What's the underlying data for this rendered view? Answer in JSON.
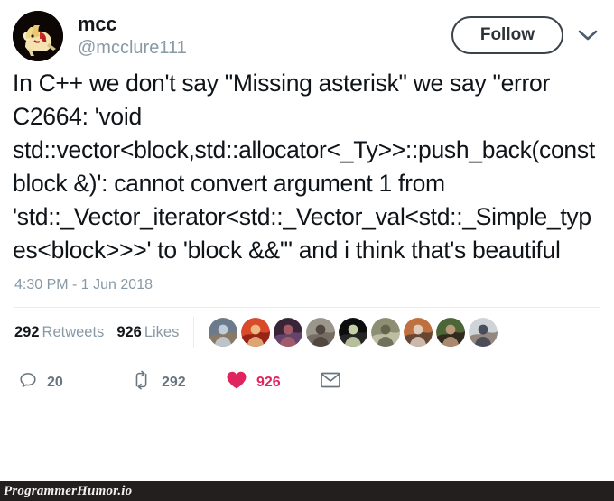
{
  "tweet": {
    "display_name": "mcc",
    "handle": "@mcclure111",
    "avatar_icon": "user-avatar-pony",
    "follow_label": "Follow",
    "caret_icon": "chevron-down-icon",
    "text": "In C++ we don't say \"Missing asterisk\" we say \"error C2664: 'void std::vector<block,std::allocator<_Ty>>::push_back(const block &)': cannot convert argument 1 from 'std::_Vector_iterator<std::_Vector_val<std::_Simple_types<block>>>' to 'block &&'\" and i think that's beautiful",
    "timestamp": "4:30 PM - 1 Jun 2018"
  },
  "stats": {
    "retweets_count": "292",
    "retweets_label": "Retweets",
    "likes_count": "926",
    "likes_label": "Likes",
    "liker_avatars": [
      {
        "name": "liker-avatar-1",
        "bg": "#6b7b8c",
        "fg": "#c9d6e2",
        "accent": "#8d7a5f"
      },
      {
        "name": "liker-avatar-2",
        "bg": "#d94a2b",
        "fg": "#f2c38a",
        "accent": "#8c1d12"
      },
      {
        "name": "liker-avatar-3",
        "bg": "#3a2438",
        "fg": "#b0616a",
        "accent": "#6d4a74"
      },
      {
        "name": "liker-avatar-4",
        "bg": "#9b968c",
        "fg": "#4a3f36",
        "accent": "#6e665c"
      },
      {
        "name": "liker-avatar-5",
        "bg": "#0d0d0d",
        "fg": "#d9e6b8",
        "accent": "#2b2b2b"
      },
      {
        "name": "liker-avatar-6",
        "bg": "#8d8f74",
        "fg": "#5d5f48",
        "accent": "#c5c6ad"
      },
      {
        "name": "liker-avatar-7",
        "bg": "#c0703e",
        "fg": "#e3d6cb",
        "accent": "#57402f"
      },
      {
        "name": "liker-avatar-8",
        "bg": "#4c6638",
        "fg": "#c9a184",
        "accent": "#2e2019"
      },
      {
        "name": "liker-avatar-9",
        "bg": "#cfd4d8",
        "fg": "#3a3f52",
        "accent": "#8a7a6e"
      }
    ]
  },
  "actions": {
    "reply": {
      "icon": "reply-icon",
      "count": "20"
    },
    "retweet": {
      "icon": "retweet-icon",
      "count": "292"
    },
    "like": {
      "icon": "heart-icon",
      "count": "926"
    },
    "message": {
      "icon": "envelope-icon"
    }
  },
  "watermark": {
    "text": "ProgrammerHumor.io"
  },
  "colors": {
    "like_red": "#e0245e",
    "muted_gray": "#8899a6",
    "icon_gray": "#66757f",
    "border": "#e6ecf0",
    "watermark_bar": "#231f1f"
  }
}
